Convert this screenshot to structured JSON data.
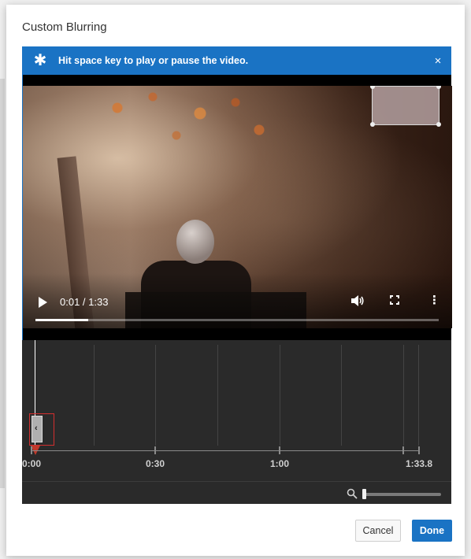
{
  "dialog": {
    "title": "Custom Blurring"
  },
  "banner": {
    "icon": "asterisk-icon",
    "star": "✱",
    "message": "Hit space key to play or pause the video.",
    "close": "×"
  },
  "player": {
    "time": "0:01 / 1:33",
    "progress_fraction": 0.13,
    "icons": [
      "play-icon",
      "volume-icon",
      "fullscreen-icon",
      "more-vert-icon"
    ],
    "more": "⋮",
    "volume": "🔊"
  },
  "timeline": {
    "labels": [
      "0:00",
      "0:30",
      "1:00",
      "1:33.8"
    ],
    "segment_handle": "‹",
    "zoom_level_fraction": 0.0
  },
  "actions": {
    "cancel": "Cancel",
    "done": "Done"
  },
  "colors": {
    "accent": "#1a73c4",
    "selection": "#d32f2f"
  }
}
